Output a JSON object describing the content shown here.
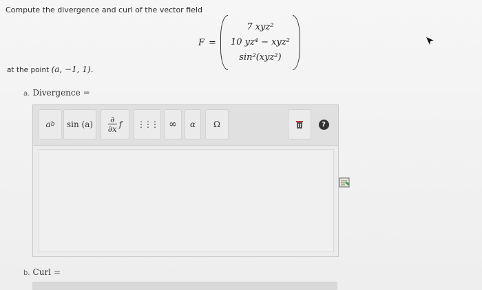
{
  "question": {
    "text": "Compute the divergence and curl of the vector field"
  },
  "vector": {
    "label": "F",
    "eq": "=",
    "components": [
      "7 xyz²",
      "10 yz⁴ − xyz²",
      "sin²(xyz²)"
    ]
  },
  "point": {
    "prefix": "at the point",
    "coords": "(a, −1, 1)."
  },
  "part_a": {
    "letter": "a.",
    "label": "Divergence",
    "eq": "="
  },
  "part_b": {
    "letter": "b.",
    "label": "Curl",
    "eq": "="
  },
  "toolbar": {
    "power_base": "a",
    "power_exp": "b",
    "sin_label": "sin (a)",
    "deriv_num": "∂",
    "deriv_den": "∂x",
    "deriv_f": "f",
    "matrix_glyph": "⋮⋮⋮",
    "infinity": "∞",
    "alpha": "α",
    "omega": "Ω",
    "help": "?"
  },
  "colors": {
    "accent_red": "#c0392b",
    "help_bg": "#333333"
  }
}
